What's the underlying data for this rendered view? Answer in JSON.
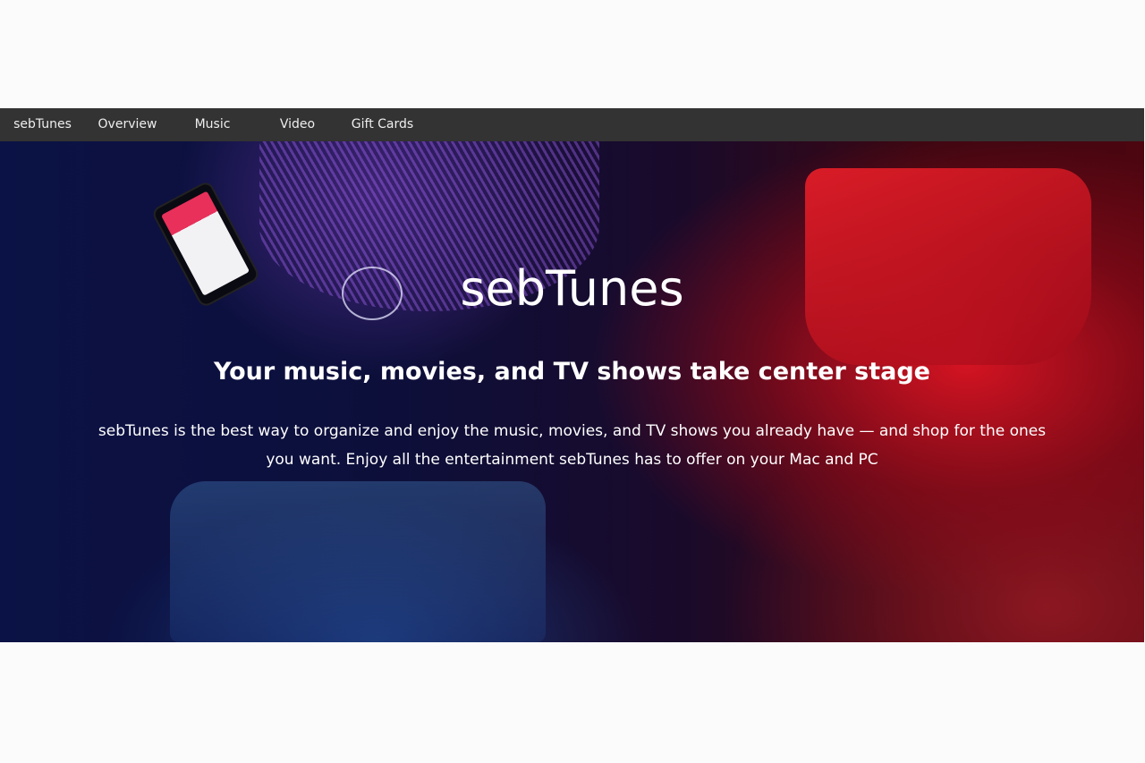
{
  "nav": {
    "brand": "sebTunes",
    "items": [
      {
        "label": "Overview"
      },
      {
        "label": "Music"
      },
      {
        "label": "Video"
      },
      {
        "label": "Gift Cards"
      }
    ]
  },
  "hero": {
    "title": "sebTunes",
    "subtitle": "Your music, movies, and TV shows take center stage",
    "body": "sebTunes is the best way to organize and enjoy the music, movies, and TV shows you already have — and shop for the ones you want. Enjoy all the entertainment sebTunes has to offer on your Mac and PC"
  },
  "colors": {
    "navbar_background": "#333333",
    "page_background": "#fcfbfc",
    "hero_accent_red": "#dc1423",
    "hero_accent_blue": "#0b1245"
  }
}
